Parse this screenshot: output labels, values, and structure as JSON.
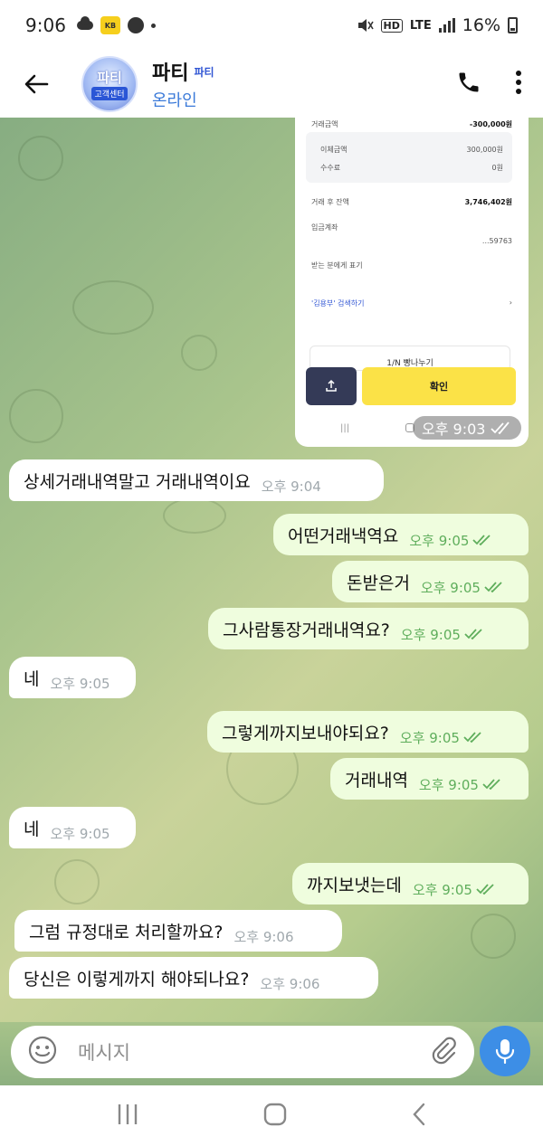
{
  "status_bar": {
    "time": "9:06",
    "battery": "16%",
    "hd": "HD",
    "lte": "LTE",
    "kbadge": "KB"
  },
  "header": {
    "name": "파티",
    "name_tag": "파티",
    "status": "온라인",
    "avatar_line1": "파티",
    "avatar_line2": "고객센터"
  },
  "screenshot": {
    "rows": [
      {
        "label": "거래금액",
        "value": "-300,000원"
      },
      {
        "label": "이체금액",
        "value": "300,000원"
      },
      {
        "label": "수수료",
        "value": "0원"
      },
      {
        "label": "거래 후 잔액",
        "value": "3,746,402원"
      },
      {
        "label": "입금계좌",
        "value": "",
        "value2": "...59763"
      },
      {
        "label": "받는 분에게 표기",
        "value": ""
      }
    ],
    "link_label": "'김용부' 검색하기",
    "split_label": "1/N 빵나누기",
    "confirm_label": "확인",
    "time": "오후 9:03"
  },
  "messages": [
    {
      "dir": "in",
      "text": "상세거래내역말고 거래내역이요",
      "time": "오후 9:04"
    },
    {
      "dir": "out",
      "text": "어떤거래낵역요",
      "time": "오후 9:05"
    },
    {
      "dir": "out",
      "text": "돈받은거",
      "time": "오후 9:05"
    },
    {
      "dir": "out",
      "text": "그사람통장거래내역요?",
      "time": "오후 9:05"
    },
    {
      "dir": "in",
      "text": "네",
      "time": "오후 9:05"
    },
    {
      "dir": "out",
      "text": "그렇게까지보내야되요?",
      "time": "오후 9:05"
    },
    {
      "dir": "out",
      "text": "거래내역",
      "time": "오후 9:05"
    },
    {
      "dir": "in",
      "text": "네",
      "time": "오후 9:05"
    },
    {
      "dir": "out",
      "text": "까지보냇는데",
      "time": "오후 9:05"
    },
    {
      "dir": "in",
      "text": "그럼 규정대로 처리할까요?",
      "time": "오후 9:06"
    },
    {
      "dir": "in",
      "text": "당신은 이렇게까지 해야되나요?",
      "time": "오후 9:06"
    }
  ],
  "composer": {
    "placeholder": "메시지"
  },
  "icons": {
    "back": "back-arrow-icon",
    "call": "phone-icon",
    "menu": "more-vertical-icon",
    "emoji": "emoji-icon",
    "attach": "paperclip-icon",
    "mic": "microphone-icon"
  },
  "colors": {
    "incoming": "#ffffff",
    "outgoing": "#effdde",
    "time_out": "#5fae5c",
    "mic": "#3d8ee6",
    "status_online": "#3b7ad9"
  }
}
